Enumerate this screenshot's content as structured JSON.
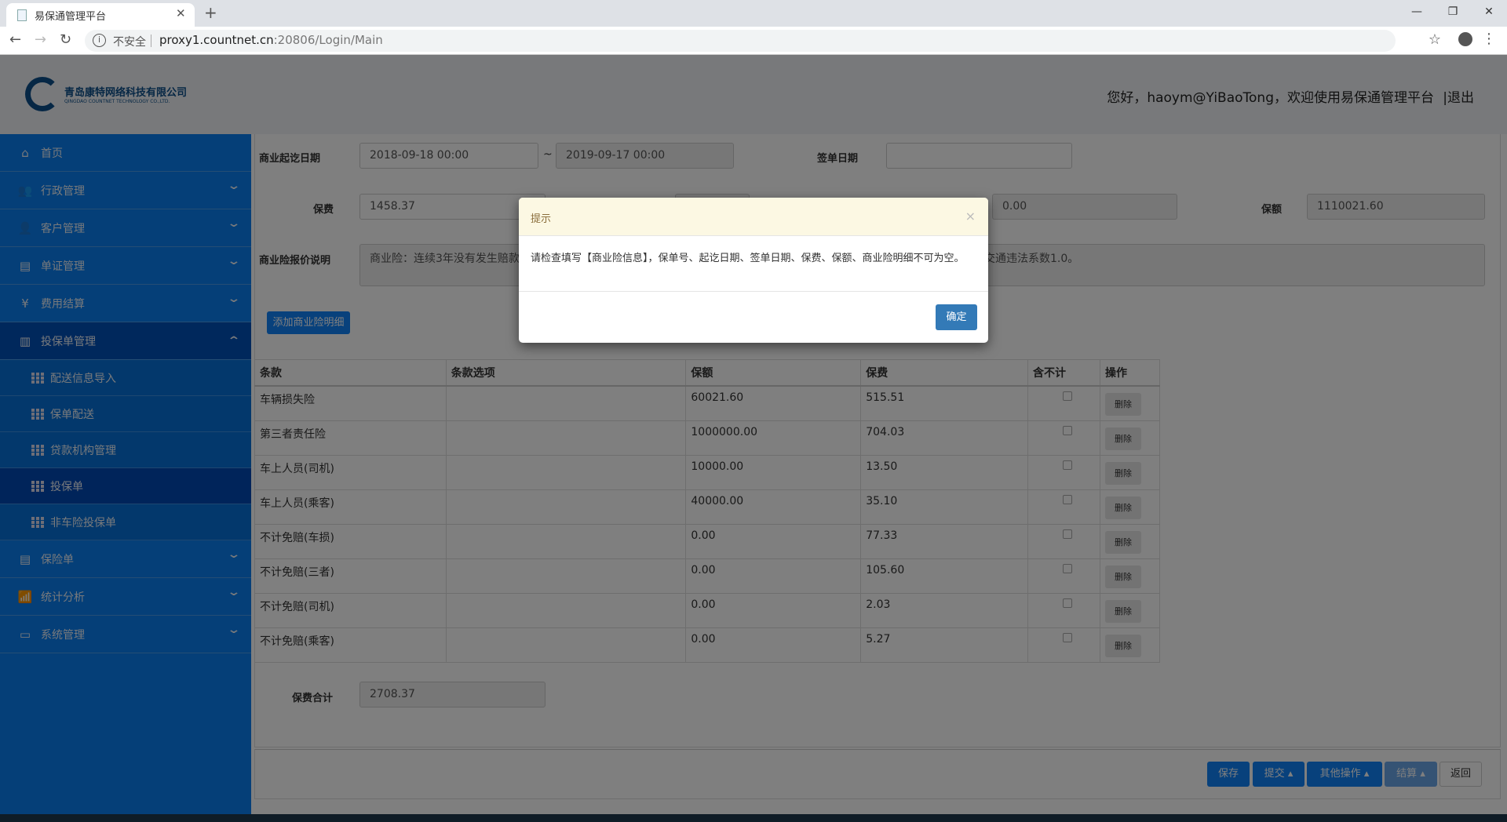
{
  "browser": {
    "tab_title": "易保通管理平台",
    "security": "不安全",
    "url_host": "proxy1.countnet.cn",
    "url_rest": ":20806/Login/Main"
  },
  "header": {
    "company_cn": "青岛康特网络科技有限公司",
    "company_en": "QINGDAO COUNTNET TECHNOLOGY CO.,LTD.",
    "greeting": "您好，haoym@YiBaoTong，欢迎使用易保通管理平台",
    "logout": "|退出"
  },
  "sidebar": {
    "items": [
      {
        "label": "首页",
        "icon": "home-icon"
      },
      {
        "label": "行政管理",
        "icon": "group-icon"
      },
      {
        "label": "客户管理",
        "icon": "users-icon"
      },
      {
        "label": "单证管理",
        "icon": "list-icon"
      },
      {
        "label": "费用结算",
        "icon": "money-bag-icon"
      },
      {
        "label": "投保单管理",
        "icon": "document-icon"
      }
    ],
    "sub_items": [
      "配送信息导入",
      "保单配送",
      "贷款机构管理",
      "投保单",
      "非车险投保单"
    ],
    "items_after": [
      {
        "label": "保险单",
        "icon": "list-icon"
      },
      {
        "label": "统计分析",
        "icon": "chart-icon"
      },
      {
        "label": "系统管理",
        "icon": "laptop-icon"
      }
    ]
  },
  "form": {
    "period_label": "商业起讫日期",
    "start": "2018-09-18 00:00",
    "tilde": "~",
    "end": "2019-09-17 00:00",
    "sign_label": "签单日期",
    "sign_value": "",
    "premium_label": "保费",
    "premium": "1458.37",
    "other_value": "0.00",
    "amount_label": "保额",
    "amount": "1110021.60",
    "desc_label": "商业险报价说明",
    "desc_left": "商业险：连续3年没有发生赔款",
    "desc_right": "交通违法系数1.0。",
    "add_button": "添加商业险明细",
    "total_label": "保费合计",
    "total": "2708.37"
  },
  "table": {
    "headers": [
      "条款",
      "条款选项",
      "保额",
      "保费",
      "含不计",
      "操作"
    ],
    "delete_label": "删除",
    "rows": [
      [
        "车辆损失险",
        "",
        "60021.60",
        "515.51"
      ],
      [
        "第三者责任险",
        "",
        "1000000.00",
        "704.03"
      ],
      [
        "车上人员(司机)",
        "",
        "10000.00",
        "13.50"
      ],
      [
        "车上人员(乘客)",
        "",
        "40000.00",
        "35.10"
      ],
      [
        "不计免赔(车损)",
        "",
        "0.00",
        "77.33"
      ],
      [
        "不计免赔(三者)",
        "",
        "0.00",
        "105.60"
      ],
      [
        "不计免赔(司机)",
        "",
        "0.00",
        "2.03"
      ],
      [
        "不计免赔(乘客)",
        "",
        "0.00",
        "5.27"
      ]
    ]
  },
  "footer": {
    "save": "保存",
    "submit": "提交",
    "other": "其他操作",
    "settle": "结算",
    "back": "返回"
  },
  "modal": {
    "title": "提示",
    "message": "请检查填写【商业险信息】，保单号、起讫日期、签单日期、保费、保额、商业险明细不可为空。",
    "ok": "确定"
  }
}
